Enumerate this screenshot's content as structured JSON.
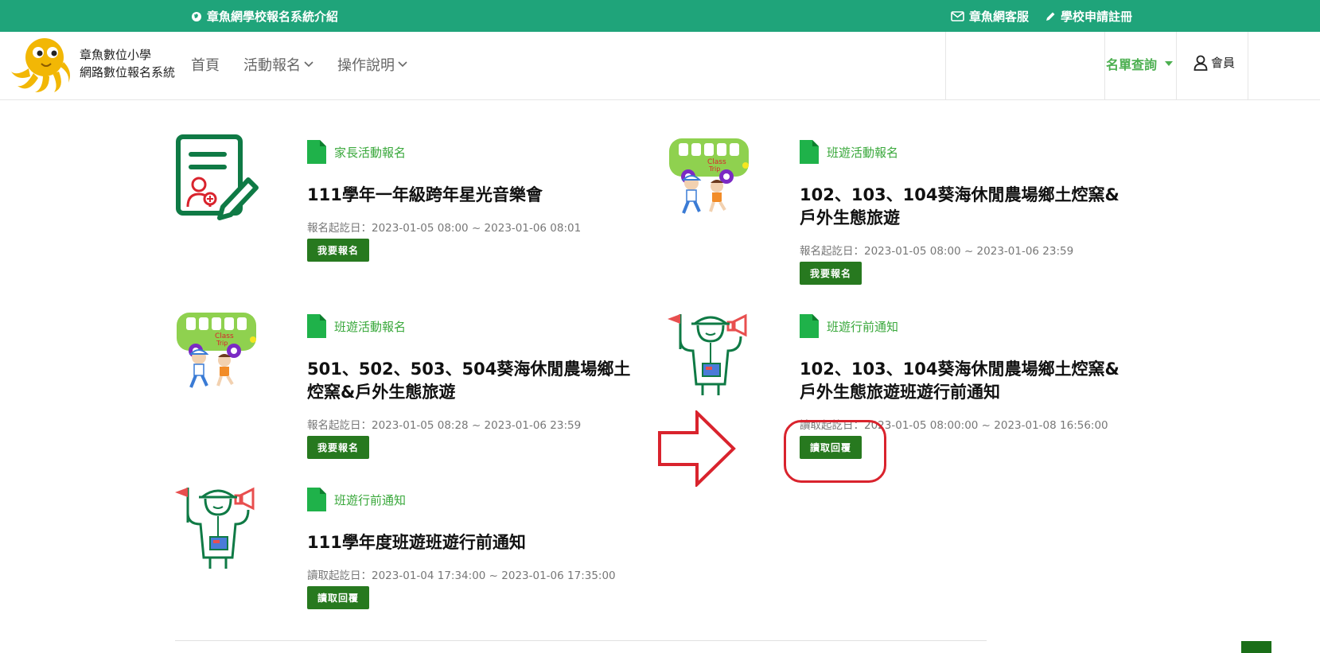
{
  "topbar": {
    "intro": "章魚網學校報名系統介紹",
    "service": "章魚網客服",
    "register": "學校申請註冊"
  },
  "header": {
    "brand_line1": "章魚數位小學",
    "brand_line2": "網路數位報名系統",
    "nav": [
      "首頁",
      "活動報名",
      "操作說明"
    ],
    "query": "名單查詢",
    "member": "會員"
  },
  "colors": {
    "topbar": "#1fa47a",
    "category": "#39a83b",
    "button": "#27791f",
    "annotation": "#d9232d"
  },
  "cards": [
    {
      "icon": "form-user-icon",
      "category": "家長活動報名",
      "title": "111學年一年級跨年星光音樂會",
      "date": "報名起訖日：2023-01-05 08:00 ~ 2023-01-06 08:01",
      "button": "我要報名"
    },
    {
      "icon": "class-trip-bus-icon",
      "category": "班遊活動報名",
      "title": "102、103、104葵海休閒農場鄉土焢窯&戶外生態旅遊",
      "date": "報名起訖日：2023-01-05 08:00 ~ 2023-01-06 23:59",
      "button": "我要報名"
    },
    {
      "icon": "class-trip-bus-icon",
      "category": "班遊活動報名",
      "title": "501、502、503、504葵海休閒農場鄉土焢窯&戶外生態旅遊",
      "date": "報名起訖日：2023-01-05 08:28 ~ 2023-01-06 23:59",
      "button": "我要報名"
    },
    {
      "icon": "tour-guide-icon",
      "category": "班遊行前通知",
      "title": "102、103、104葵海休閒農場鄉土焢窯&戶外生態旅遊班遊行前通知",
      "date": "讀取起訖日：2023-01-05 08:00:00 ~ 2023-01-08 16:56:00",
      "button": "讀取回覆"
    },
    {
      "icon": "tour-guide-icon",
      "category": "班遊行前通知",
      "title": "111學年度班遊班遊行前通知",
      "date": "讀取起訖日：2023-01-04 17:34:00 ~ 2023-01-06 17:35:00",
      "button": "讀取回覆"
    }
  ]
}
